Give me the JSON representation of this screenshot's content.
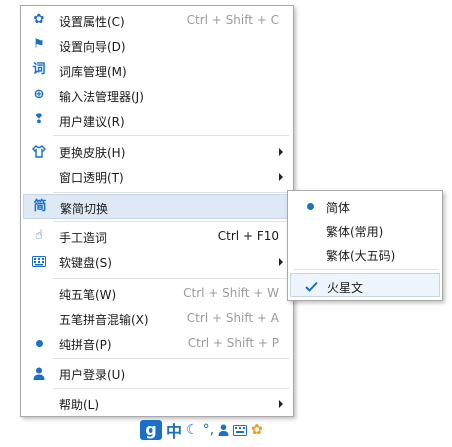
{
  "main_menu": {
    "items": [
      {
        "icon": "gear-icon",
        "label": "设置属性(C)",
        "hotkey": "Ctrl + Shift + C"
      },
      {
        "icon": "flag-icon",
        "label": "设置向导(D)"
      },
      {
        "icon": "dictionary-icon",
        "label": "词库管理(M)"
      },
      {
        "icon": "ime-manager-icon",
        "label": "输入法管理器(J)"
      },
      {
        "icon": "feedback-user-icon",
        "label": "用户建议(R)"
      },
      {
        "icon": "shirt-icon",
        "label": "更换皮肤(H)"
      },
      {
        "label": "窗口透明(T)"
      },
      {
        "icon": "traditional-char-icon",
        "icon_text": "简",
        "label": "繁简切换"
      },
      {
        "icon": "hand-pointer-icon",
        "label": "手工造词",
        "hotkey": "Ctrl + F10"
      },
      {
        "icon": "keyboard-icon",
        "label": "软键盘(S)"
      },
      {
        "label": "纯五笔(W)",
        "hotkey": "Ctrl + Shift + W"
      },
      {
        "label": "五笔拼音混输(X)",
        "hotkey": "Ctrl + Shift + A"
      },
      {
        "icon": "radio-dot-icon",
        "label": "纯拼音(P)",
        "hotkey": "Ctrl + Shift + P"
      },
      {
        "icon": "user-icon",
        "label": "用户登录(U)"
      },
      {
        "label": "帮助(L)"
      }
    ]
  },
  "sub_menu": {
    "items": [
      {
        "label": "简体",
        "state": "radio-selected"
      },
      {
        "label": "繁体(常用)"
      },
      {
        "label": "繁体(大五码)"
      },
      {
        "label": "火星文",
        "state": "checked"
      }
    ]
  },
  "taskbar": {
    "logo": "g",
    "mode_char": "中",
    "icons": [
      "moon-icon",
      "punctuation-icon",
      "user-icon",
      "keyboard-icon",
      "gear-icon"
    ]
  },
  "colors": {
    "accent": "#1a6fc6",
    "hover": "#dfe9f5",
    "hotkey": "#9b9b9b",
    "orange": "#f29a1e"
  }
}
